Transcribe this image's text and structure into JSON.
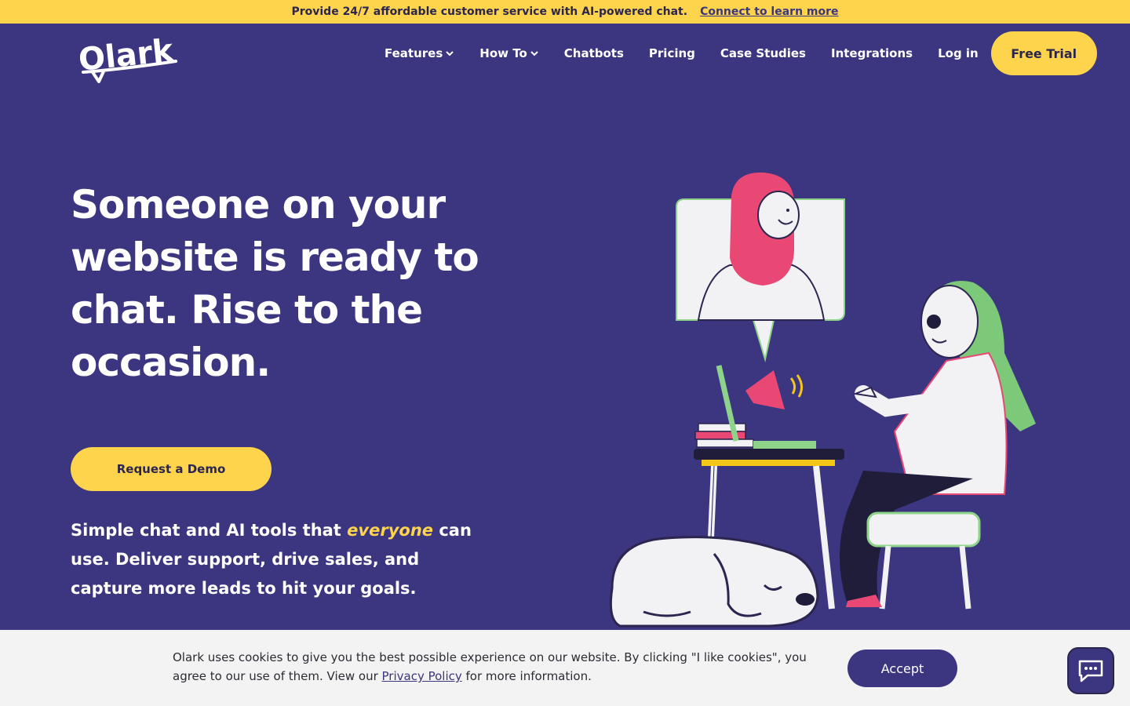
{
  "promo": {
    "text": "Provide 24/7 affordable customer service with AI-powered chat.",
    "link": "Connect to learn more"
  },
  "brand": {
    "logo_text": "Olark"
  },
  "nav": {
    "features": "Features",
    "how_to": "How To",
    "chatbots": "Chatbots",
    "pricing": "Pricing",
    "case_studies": "Case Studies",
    "integrations": "Integrations",
    "login": "Log in",
    "free_trial": "Free Trial"
  },
  "hero": {
    "title": "Someone on your website is ready to chat. Rise to the occasion.",
    "demo_button": "Request a Demo",
    "sub_before": "Simple chat and AI tools that ",
    "sub_highlight": "everyone",
    "sub_after": " can use. Deliver support, drive sales, and capture more leads to hit your goals."
  },
  "cookie": {
    "text_before": "Olark uses cookies to give you the best possible experience on our website. By clicking \"I like cookies\", you agree to our use of them. View our ",
    "link": "Privacy Policy",
    "text_after": " for more information.",
    "accept": "Accept"
  },
  "colors": {
    "brand_purple": "#3c357f",
    "accent_yellow": "#fdd44c"
  },
  "icons": {
    "chevron": "chevron-down-icon",
    "chat_widget": "chat-bubble-icon"
  }
}
